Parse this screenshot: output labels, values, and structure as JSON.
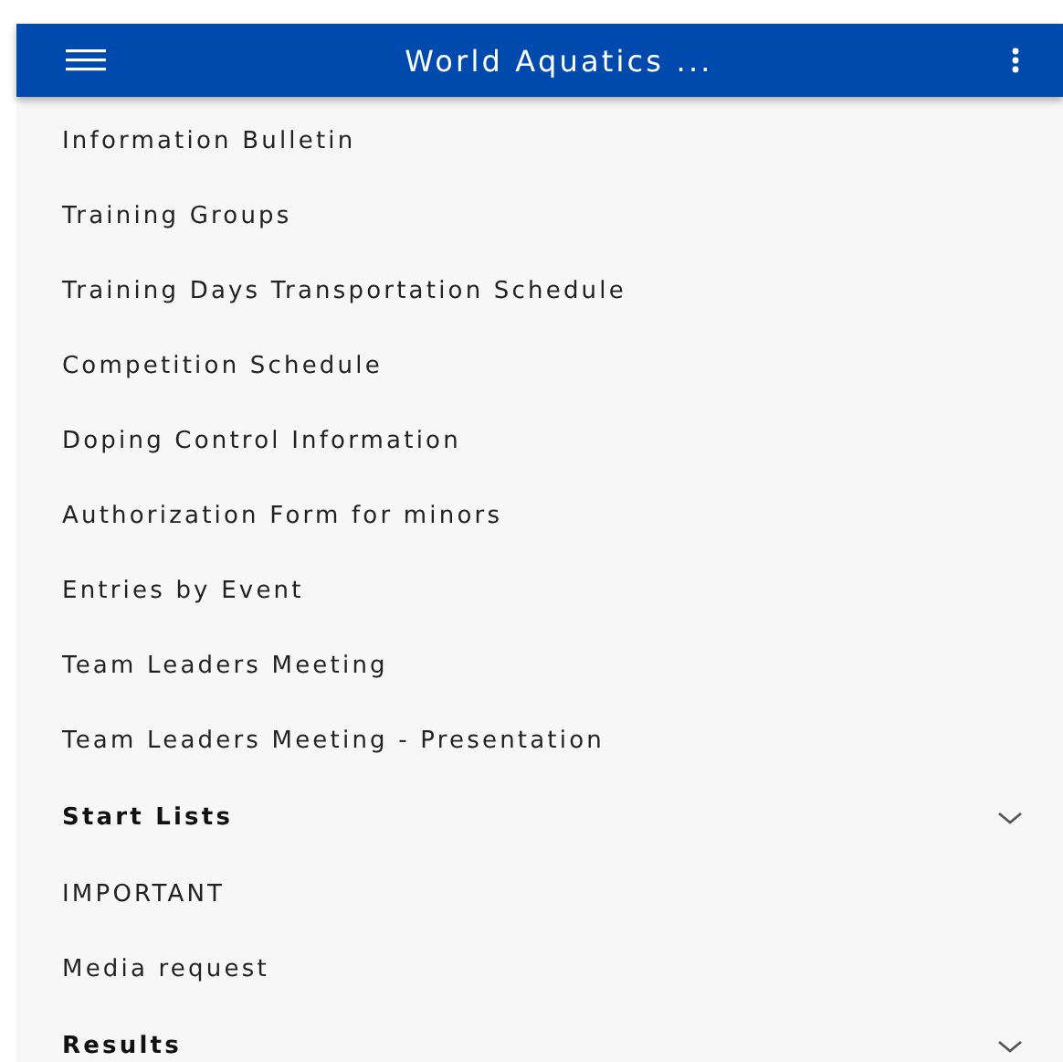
{
  "app_bar": {
    "title": "World Aquatics ..."
  },
  "menu_items": [
    {
      "kind": "link",
      "label": "Information Bulletin"
    },
    {
      "kind": "link",
      "label": "Training Groups"
    },
    {
      "kind": "link",
      "label": "Training Days Transportation Schedule"
    },
    {
      "kind": "link",
      "label": "Competition Schedule"
    },
    {
      "kind": "link",
      "label": "Doping Control Information"
    },
    {
      "kind": "link",
      "label": "Authorization Form for minors"
    },
    {
      "kind": "link",
      "label": "Entries by Event"
    },
    {
      "kind": "link",
      "label": "Team Leaders Meeting"
    },
    {
      "kind": "link",
      "label": "Team Leaders Meeting - Presentation"
    },
    {
      "kind": "section",
      "label": "Start Lists",
      "expanded": false
    },
    {
      "kind": "link",
      "label": "IMPORTANT"
    },
    {
      "kind": "link",
      "label": "Media request"
    },
    {
      "kind": "section",
      "label": "Results",
      "expanded": false
    }
  ]
}
